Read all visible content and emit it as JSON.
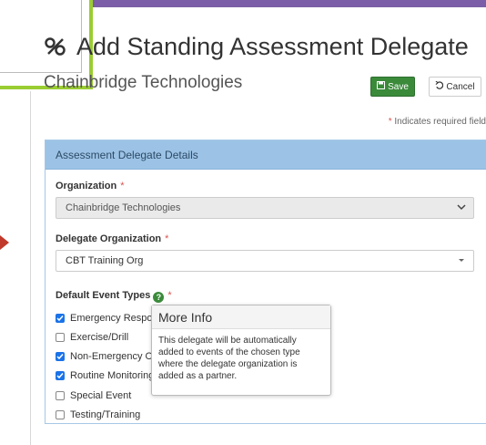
{
  "page": {
    "title": "Add Standing Assessment Delegate",
    "organization_name": "Chainbridge Technologies",
    "required_note": "Indicates required field"
  },
  "toolbar": {
    "save_label": "Save",
    "cancel_label": "Cancel"
  },
  "panel": {
    "header": "Assessment Delegate Details",
    "organization": {
      "label": "Organization",
      "value": "Chainbridge Technologies"
    },
    "delegate_organization": {
      "label": "Delegate Organization",
      "value": "CBT Training Org"
    },
    "default_event_types": {
      "label": "Default Event Types",
      "options": [
        {
          "label": "Emergency Response",
          "checked": true
        },
        {
          "label": "Exercise/Drill",
          "checked": false
        },
        {
          "label": "Non-Emergency Operations",
          "checked": true
        },
        {
          "label": "Routine Monitoring",
          "checked": true
        },
        {
          "label": "Special Event",
          "checked": false
        },
        {
          "label": "Testing/Training",
          "checked": false
        }
      ]
    }
  },
  "popover": {
    "title": "More Info",
    "body": "This delegate will be automatically added to events of the chosen type where the delegate organization is added as a partner."
  },
  "colors": {
    "accent_purple": "#7b5ea7",
    "highlight_green": "#9acd32",
    "save_green": "#3a8a3a",
    "panel_header_blue": "#9cc3e5",
    "required_red": "#d9534f",
    "checkbox_blue": "#1a73e8"
  }
}
